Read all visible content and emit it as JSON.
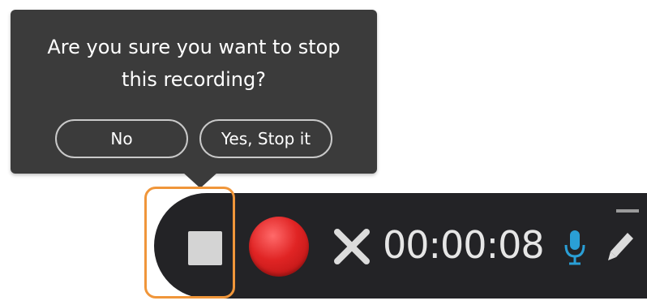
{
  "popover": {
    "message": "Are you sure you want to stop\nthis recording?",
    "no_label": "No",
    "yes_label": "Yes, Stop it"
  },
  "toolbar": {
    "timer": "00:00:08",
    "icons": {
      "stop": "stop-icon",
      "record": "record-icon",
      "cancel": "close-icon",
      "mic": "microphone-icon",
      "pencil": "pencil-icon",
      "minimize": "minimize-icon"
    }
  },
  "colors": {
    "popover_bg": "#3b3b3b",
    "toolbar_bg": "#232326",
    "highlight": "#f0963a",
    "record_red": "#e02424",
    "mic_blue": "#2a9fd6"
  }
}
